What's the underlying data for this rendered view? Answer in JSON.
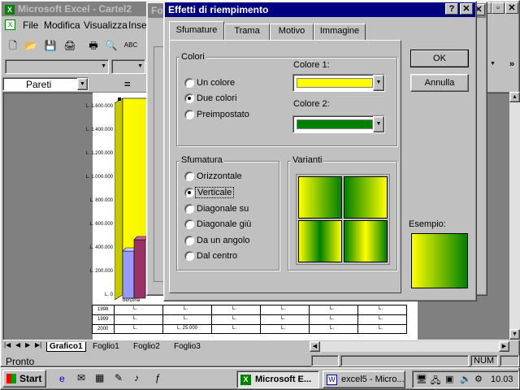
{
  "excel": {
    "title": "Microsoft Excel - Cartel2",
    "menu": [
      "File",
      "Modifica",
      "Visualizza",
      "Inse"
    ],
    "name_box": "Pareti",
    "formula_eq": "=",
    "back_window_title": "Fo"
  },
  "dialog": {
    "title": "Effetti di riempimento",
    "help": "?",
    "tabs": [
      "Sfumature",
      "Trama",
      "Motivo",
      "Immagine"
    ],
    "active_tab": "Sfumature",
    "colori_group": "Colori",
    "color_options": [
      "Un colore",
      "Due colori",
      "Preimpostato"
    ],
    "selected_color_option": "Due colori",
    "colore1_label": "Colore 1:",
    "colore1_value": "#ffff00",
    "colore2_label": "Colore 2:",
    "colore2_value": "#008000",
    "sfumatura_group": "Sfumatura",
    "shading_styles": [
      "Orizzontale",
      "Verticale",
      "Diagonale su",
      "Diagonale giù",
      "Da un angolo",
      "Dal centro"
    ],
    "selected_shading": "Verticale",
    "varianti_label": "Varianti",
    "esempio_label": "Esempio:",
    "ok": "OK",
    "cancel": "Annulla"
  },
  "chart": {
    "y_ticks": [
      "L. 1.600.000",
      "L. 1.400.000",
      "L. 1.200.000",
      "L. 1.000.000",
      "L. 800.000",
      "L. 600.000",
      "L. 400.000",
      "L. 200.000",
      "L. 0"
    ],
    "category": "benzina",
    "table_rows": [
      {
        "year": "1998",
        "cells": [
          "L.",
          "L.",
          "L.",
          "L.",
          "L.",
          "L."
        ]
      },
      {
        "year": "1999",
        "cells": [
          "L.",
          "L.",
          "L.",
          "L.",
          "L.",
          "L."
        ]
      },
      {
        "year": "2000",
        "cells": [
          "L.",
          "L. 25.000",
          "L.",
          "L.",
          "L.",
          "L."
        ]
      }
    ]
  },
  "sheets": [
    "Grafico1",
    "Foglio1",
    "Foglio2",
    "Foglio3"
  ],
  "status": {
    "text": "Pronto",
    "num": "NUM"
  },
  "taskbar": {
    "start": "Start",
    "tasks": [
      "Microsoft E...",
      "excel5 - Micro..."
    ],
    "clock": "10.03"
  },
  "colors": {
    "titlebar": "#000080",
    "desktop": "#008080",
    "face": "#c0c0c0"
  }
}
